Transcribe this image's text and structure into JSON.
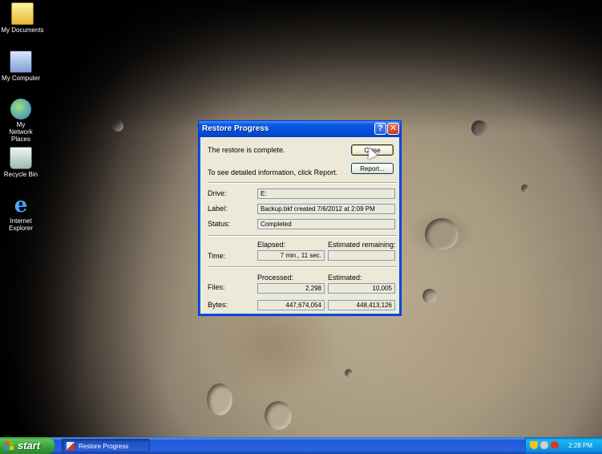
{
  "desktop": {
    "icons": [
      {
        "label": "My Documents",
        "icon": "folder-documents-icon"
      },
      {
        "label": "My Computer",
        "icon": "computer-icon"
      },
      {
        "label": "My Network Places",
        "icon": "network-places-icon"
      },
      {
        "label": "Recycle Bin",
        "icon": "recycle-bin-icon"
      },
      {
        "label": "Internet Explorer",
        "icon": "internet-explorer-icon",
        "glyph": "e"
      }
    ]
  },
  "dialog": {
    "title": "Restore Progress",
    "help_glyph": "?",
    "close_glyph": "✕",
    "message": "The restore is complete.",
    "report_hint": "To see detailed information, click Report.",
    "close_label": "Close",
    "report_label": "Report...",
    "drive_label": "Drive:",
    "drive_value": "E:",
    "label_label": "Label:",
    "label_value": "Backup.bkf created 7/6/2012 at 2:09 PM",
    "status_label": "Status:",
    "status_value": "Completed",
    "elapsed_header": "Elapsed:",
    "remaining_header": "Estimated remaining:",
    "time_label": "Time:",
    "time_elapsed": "7 min., 11 sec.",
    "time_remaining": "",
    "processed_header": "Processed:",
    "estimated_header": "Estimated:",
    "files_label": "Files:",
    "files_processed": "2,298",
    "files_estimated": "10,005",
    "bytes_label": "Bytes:",
    "bytes_processed": "447,674,054",
    "bytes_estimated": "448,413,126"
  },
  "taskbar": {
    "start_label": "start",
    "task_label": "Restore Progress",
    "clock": "2:28 PM",
    "tray_icons": [
      "security-shield-icon",
      "network-icon",
      "alert-icon"
    ]
  },
  "colors": {
    "titlebar": "#0a5ae6",
    "dialog_bg": "#ece9d8",
    "taskbar": "#2663e0",
    "start": "#36a236"
  }
}
